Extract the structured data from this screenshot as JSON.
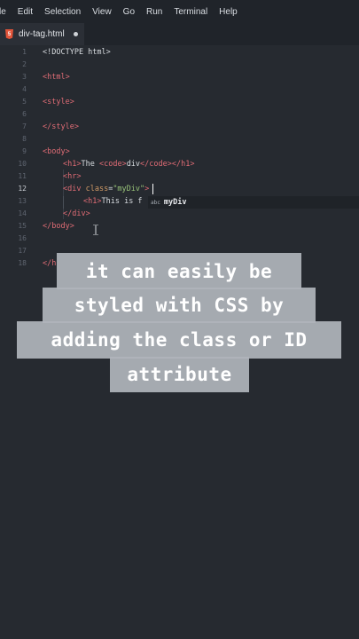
{
  "menu": [
    "le",
    "Edit",
    "Selection",
    "View",
    "Go",
    "Run",
    "Terminal",
    "Help"
  ],
  "tab": {
    "filename": "div-tag.html",
    "icon": "html5-icon",
    "icon_glyph": "5"
  },
  "line_numbers": [
    "1",
    "2",
    "3",
    "4",
    "5",
    "6",
    "7",
    "8",
    "9",
    "10",
    "11",
    "12",
    "13",
    "14",
    "15",
    "16",
    "17",
    "18"
  ],
  "active_line": "12",
  "code": {
    "l1": "<!DOCTYPE html>",
    "l3": "<html>",
    "l5": "<style>",
    "l7": "</style>",
    "l9": "<body>",
    "l10a": "<h1>",
    "l10b": "The ",
    "l10c": "<code>",
    "l10d": "div",
    "l10e": "</code>",
    "l10f": "</h1>",
    "l11": "<hr>",
    "l12a": "<div ",
    "l12b": "class",
    "l12c": "=",
    "l12d": "\"myDiv\"",
    "l12e": ">",
    "l13a": "<h1>",
    "l13b": "This is f",
    "l14": "</div>",
    "l15": "</body>",
    "l18": "</h"
  },
  "autocomplete": {
    "kind": "abc",
    "suggestion": "myDiv"
  },
  "caption": {
    "line1": "it can easily be",
    "line2": "styled with CSS by",
    "line3": "adding the class or ID",
    "line4": "attribute"
  },
  "colors": {
    "background": "#262a30",
    "tag": "#e06c75",
    "string": "#98c379",
    "attribute": "#d19a66",
    "caption_bg": "#afb4ba"
  }
}
